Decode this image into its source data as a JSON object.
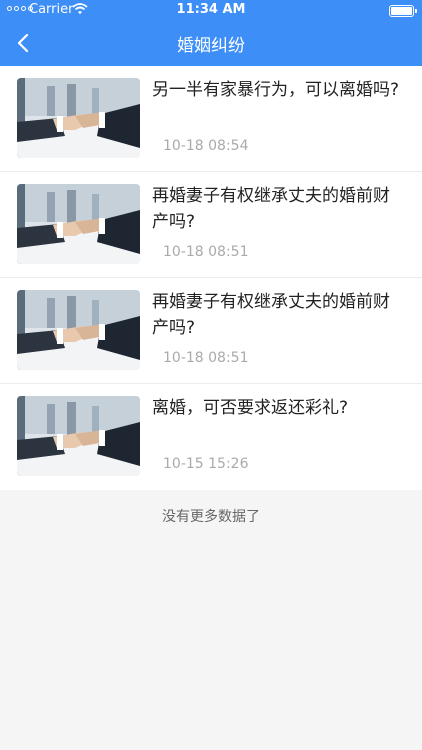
{
  "status_bar": {
    "carrier": "Carrier",
    "time": "11:34 AM"
  },
  "nav": {
    "title": "婚姻纠纷",
    "back_icon": "chevron-left-icon"
  },
  "items": [
    {
      "title": "另一半有家暴行为，可以离婚吗?",
      "date": "10-18 08:54"
    },
    {
      "title": "再婚妻子有权继承丈夫的婚前财产吗?",
      "date": "10-18 08:51"
    },
    {
      "title": "再婚妻子有权继承丈夫的婚前财产吗?",
      "date": "10-18 08:51"
    },
    {
      "title": "离婚，可否要求返还彩礼?",
      "date": "10-15 15:26"
    }
  ],
  "footer": {
    "no_more": "没有更多数据了"
  },
  "colors": {
    "header": "#3d8ef6",
    "background": "#f5f5f5"
  }
}
